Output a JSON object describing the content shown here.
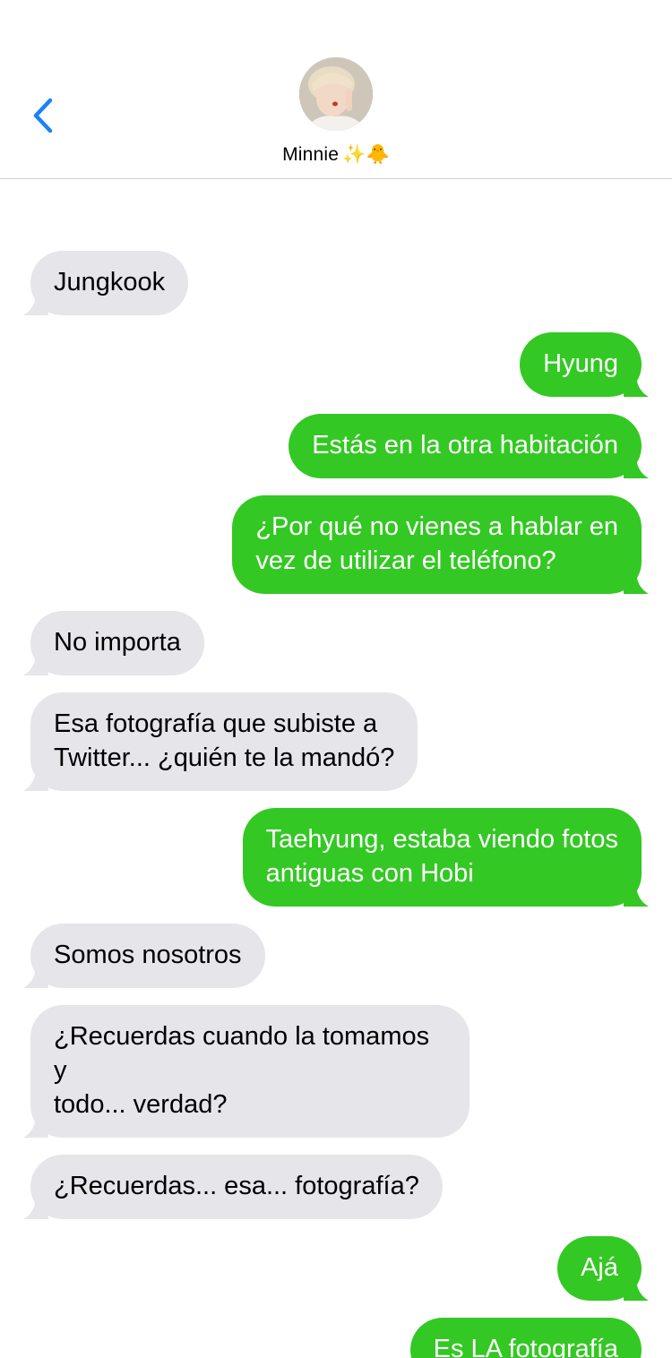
{
  "header": {
    "contact_name": "Minnie",
    "contact_emoji": "✨🐥",
    "back_icon": "chevron-left-icon",
    "accent_color": "#1a82fb"
  },
  "colors": {
    "incoming_bubble": "#e5e5ea",
    "outgoing_bubble": "#34c824"
  },
  "messages": [
    {
      "direction": "in",
      "text": "Jungkook"
    },
    {
      "direction": "out",
      "text": "Hyung"
    },
    {
      "direction": "out",
      "text": "Estás en la otra habitación"
    },
    {
      "direction": "out",
      "text": "¿Por qué no vienes a hablar en vez de utilizar el teléfono?"
    },
    {
      "direction": "in",
      "text": "No importa"
    },
    {
      "direction": "in",
      "text": "Esa fotografía que subiste a Twitter... ¿quién te la mandó?"
    },
    {
      "direction": "out",
      "text": "Taehyung, estaba viendo fotos antiguas con Hobi"
    },
    {
      "direction": "in",
      "text": "Somos nosotros"
    },
    {
      "direction": "in",
      "text": "¿Recuerdas cuando la tomamos y todo... verdad?"
    },
    {
      "direction": "in",
      "text": "¿Recuerdas... esa... fotografía?"
    },
    {
      "direction": "out",
      "text": "Ajá"
    },
    {
      "direction": "out",
      "text": "Es LA fotografía"
    }
  ]
}
